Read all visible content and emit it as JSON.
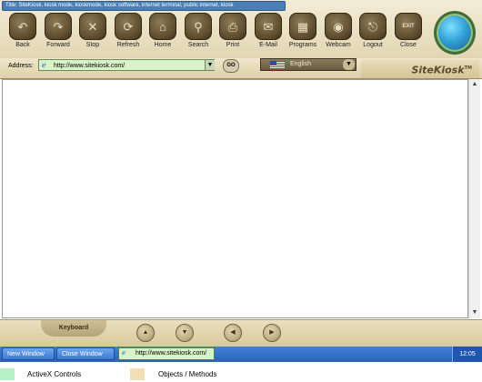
{
  "window": {
    "title": "Title: SiteKiosk, kiosk mode, kioskmode, kiosk software, internet terminal, public internet, kiosk"
  },
  "toolbar": {
    "buttons": [
      {
        "label": "Back",
        "icon": "back-arrow-icon",
        "glyph": "↶"
      },
      {
        "label": "Forward",
        "icon": "forward-arrow-icon",
        "glyph": "↷"
      },
      {
        "label": "Stop",
        "icon": "stop-icon",
        "glyph": "✕"
      },
      {
        "label": "Refresh",
        "icon": "refresh-icon",
        "glyph": "⟳"
      },
      {
        "label": "Home",
        "icon": "home-icon",
        "glyph": "⌂"
      },
      {
        "label": "Search",
        "icon": "search-icon",
        "glyph": "⚲"
      },
      {
        "label": "Print",
        "icon": "print-icon",
        "glyph": "⎙"
      },
      {
        "label": "E-Mail",
        "icon": "email-icon",
        "glyph": "✉"
      },
      {
        "label": "Programs",
        "icon": "programs-icon",
        "glyph": "▦"
      },
      {
        "label": "Webcam",
        "icon": "webcam-icon",
        "glyph": "◉"
      },
      {
        "label": "Logout",
        "icon": "logout-icon",
        "glyph": "⎋"
      },
      {
        "label": "Close",
        "icon": "exit-icon",
        "glyph": "EXIT"
      }
    ]
  },
  "address": {
    "label": "Address:",
    "url": "http://www.sitekiosk.com/",
    "go_label": "GO"
  },
  "language": {
    "selected": "English"
  },
  "brand": {
    "name": "SiteKiosk",
    "trademark": "TM"
  },
  "keyboard_bar": {
    "tab_label": "Keyboard"
  },
  "taskbar": {
    "buttons": [
      "New Window",
      "Close Window"
    ],
    "url": "http://www.sitekiosk.com/",
    "clock": "12:05"
  },
  "legend": [
    {
      "label": "ActiveX Controls",
      "color": "#b5f2c6"
    },
    {
      "label": "Objects / Methods",
      "color": "#f2dfb5"
    }
  ],
  "colors": {
    "activex": "#b5f2c6",
    "objects": "#f2dfb5",
    "toolbar_bg": "#e2d6b2",
    "taskbar": "#2a63b8"
  }
}
